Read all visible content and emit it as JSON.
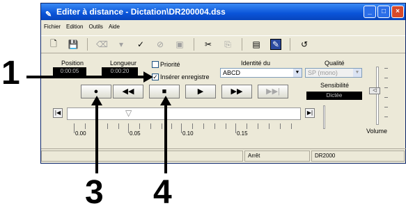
{
  "window": {
    "title": "Editer à distance - Dictation\\DR200004.dss"
  },
  "menu": [
    "Fichier",
    "Edition",
    "Outils",
    "Aide"
  ],
  "fields": {
    "position_label": "Position",
    "position_value": "0:00:05",
    "length_label": "Longueur",
    "length_value": "0:00:20",
    "priority_label": "Priorité",
    "insert_label": "Insérer enregistre",
    "identity_label": "Identité du",
    "identity_value": "ABCD",
    "quality_label": "Qualité",
    "quality_value": "SP (mono)",
    "sensitivity_label": "Sensibilité",
    "sensitivity_value": "Dictée",
    "volume_label": "Volume"
  },
  "timeline": {
    "ticks": [
      "0.00",
      "0.05",
      "0.10",
      "0.15"
    ],
    "position_fraction": 0.25
  },
  "status": {
    "state": "Arrêt",
    "device": "DR2000"
  },
  "callouts": {
    "n1": "1",
    "n3": "3",
    "n4": "4"
  }
}
